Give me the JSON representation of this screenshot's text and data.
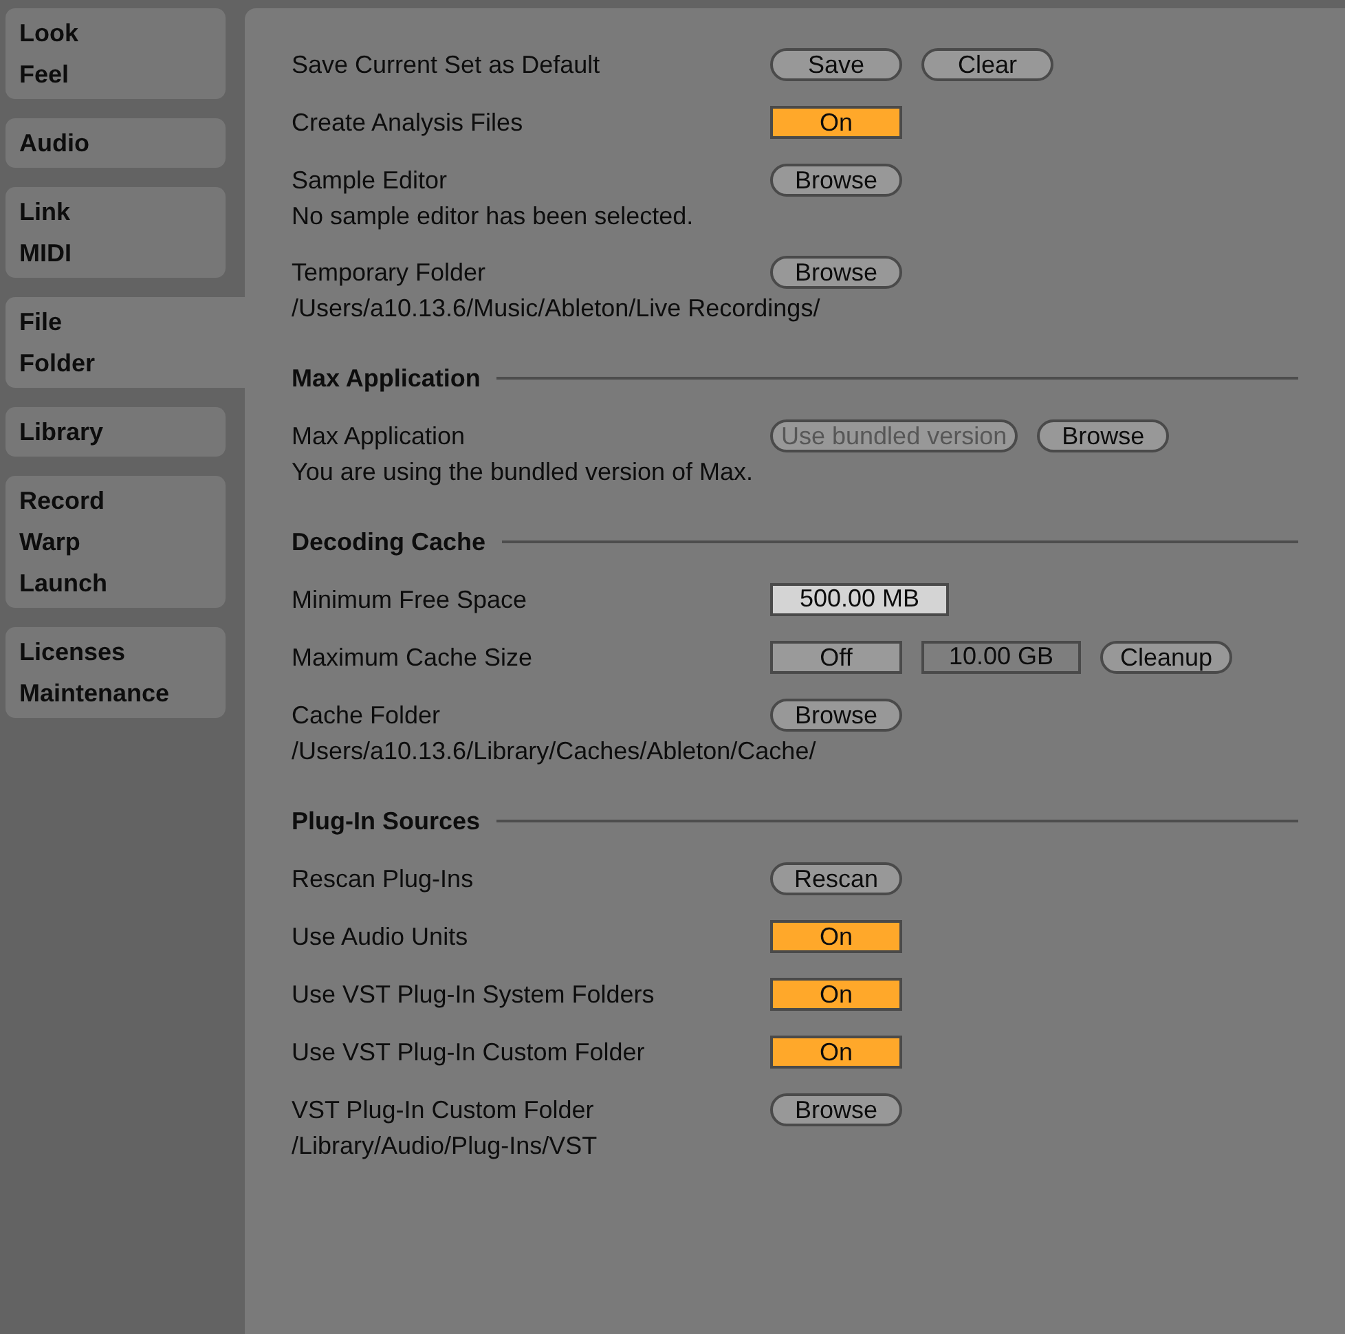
{
  "sidebar": {
    "tabs": [
      {
        "lines": [
          "Look",
          "Feel"
        ],
        "selected": false
      },
      {
        "lines": [
          "Audio"
        ],
        "selected": false
      },
      {
        "lines": [
          "Link",
          "MIDI"
        ],
        "selected": false
      },
      {
        "lines": [
          "File",
          "Folder"
        ],
        "selected": true
      },
      {
        "lines": [
          "Library"
        ],
        "selected": false
      },
      {
        "lines": [
          "Record",
          "Warp",
          "Launch"
        ],
        "selected": false
      },
      {
        "lines": [
          "Licenses",
          "Maintenance"
        ],
        "selected": false
      }
    ]
  },
  "settings": [
    {
      "kind": "row",
      "label": "Save Current Set as Default",
      "controls": [
        {
          "kind": "button",
          "text": "Save",
          "disabled": false
        },
        {
          "kind": "button",
          "text": "Clear",
          "disabled": false
        }
      ]
    },
    {
      "kind": "row",
      "label": "Create Analysis Files",
      "controls": [
        {
          "kind": "toggle",
          "text": "On",
          "on": true
        }
      ]
    },
    {
      "kind": "row",
      "label": "Sample Editor",
      "controls": [
        {
          "kind": "button",
          "text": "Browse",
          "disabled": false
        }
      ]
    },
    {
      "kind": "note",
      "text": "No sample editor has been selected."
    },
    {
      "kind": "row",
      "label": "Temporary Folder",
      "controls": [
        {
          "kind": "button",
          "text": "Browse",
          "disabled": false
        }
      ]
    },
    {
      "kind": "note",
      "text": "/Users/a10.13.6/Music/Ableton/Live Recordings/"
    },
    {
      "kind": "section",
      "title": "Max Application"
    },
    {
      "kind": "row",
      "label": "Max Application",
      "controls": [
        {
          "kind": "button",
          "text": "Use bundled version",
          "disabled": true
        },
        {
          "kind": "button",
          "text": "Browse",
          "disabled": false
        }
      ]
    },
    {
      "kind": "note",
      "text": "You are using the bundled version of Max."
    },
    {
      "kind": "section",
      "title": "Decoding Cache"
    },
    {
      "kind": "row",
      "label": "Minimum Free Space",
      "controls": [
        {
          "kind": "value",
          "text": "500.00 MB",
          "focused": true
        }
      ]
    },
    {
      "kind": "row",
      "label": "Maximum Cache Size",
      "controls": [
        {
          "kind": "toggle",
          "text": "Off",
          "on": false
        },
        {
          "kind": "value",
          "text": "10.00 GB",
          "focused": false
        },
        {
          "kind": "button",
          "text": "Cleanup",
          "disabled": false
        }
      ]
    },
    {
      "kind": "row",
      "label": "Cache Folder",
      "controls": [
        {
          "kind": "button",
          "text": "Browse",
          "disabled": false
        }
      ]
    },
    {
      "kind": "note",
      "text": "/Users/a10.13.6/Library/Caches/Ableton/Cache/"
    },
    {
      "kind": "section",
      "title": "Plug-In Sources"
    },
    {
      "kind": "row",
      "label": "Rescan Plug-Ins",
      "controls": [
        {
          "kind": "button",
          "text": "Rescan",
          "disabled": false
        }
      ]
    },
    {
      "kind": "row",
      "label": "Use Audio Units",
      "controls": [
        {
          "kind": "toggle",
          "text": "On",
          "on": true
        }
      ]
    },
    {
      "kind": "row",
      "label": "Use VST Plug-In System Folders",
      "controls": [
        {
          "kind": "toggle",
          "text": "On",
          "on": true
        }
      ]
    },
    {
      "kind": "row",
      "label": "Use VST Plug-In Custom Folder",
      "controls": [
        {
          "kind": "toggle",
          "text": "On",
          "on": true
        }
      ]
    },
    {
      "kind": "row",
      "label": "VST Plug-In Custom Folder",
      "controls": [
        {
          "kind": "button",
          "text": "Browse",
          "disabled": false
        }
      ]
    },
    {
      "kind": "note",
      "text": "/Library/Audio/Plug-Ins/VST"
    }
  ]
}
